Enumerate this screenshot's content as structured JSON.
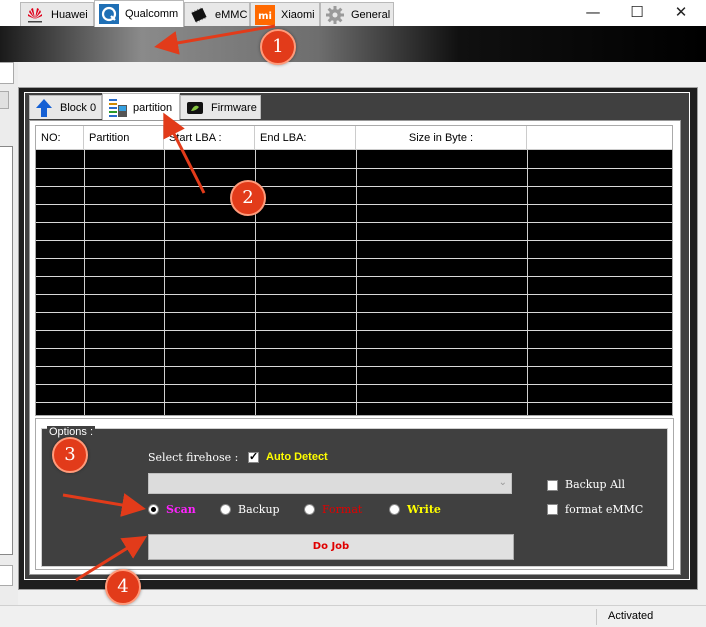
{
  "window": {
    "minimize_glyph": "—",
    "maximize_glyph": "☐",
    "close_glyph": "✕"
  },
  "main_tabs": [
    {
      "label": "Huawei",
      "icon": "huawei-logo-icon"
    },
    {
      "label": "Qualcomm",
      "icon": "qualcomm-logo-icon",
      "active": true
    },
    {
      "label": "eMMC",
      "icon": "emmc-chip-icon"
    },
    {
      "label": "Xiaomi",
      "icon": "xiaomi-logo-icon"
    },
    {
      "label": "General",
      "icon": "gear-icon"
    }
  ],
  "sub_tabs": [
    {
      "label": "Block 0",
      "icon": "upload-arrow-icon"
    },
    {
      "label": "partition",
      "icon": "partition-icon",
      "active": true
    },
    {
      "label": "Firmware",
      "icon": "firmware-chip-icon"
    }
  ],
  "table": {
    "columns": [
      "NO:",
      "Partition",
      "Start LBA :",
      "End LBA:",
      "Size in Byte :",
      ""
    ],
    "empty_rows": 15
  },
  "options": {
    "legend": "Options :",
    "select_firehose_label": "Select firehose :",
    "auto_detect_label": "Auto Detect",
    "auto_detect_checked": true,
    "firehose_value": "",
    "radios": [
      {
        "label": "Scan",
        "color": "#ff22ff",
        "selected": true
      },
      {
        "label": "Backup",
        "color": "#ffffff",
        "selected": false
      },
      {
        "label": "Format",
        "color": "#e00000",
        "selected": false
      },
      {
        "label": "Write",
        "color": "#ffff00",
        "selected": false
      }
    ],
    "backup_all_label": "Backup All",
    "backup_all_checked": false,
    "format_emmc_label": "format eMMC",
    "format_emmc_checked": false,
    "do_job_label": "Do Job"
  },
  "status": {
    "text": "Activated"
  },
  "annotations": {
    "marker_1": "1",
    "marker_2": "2",
    "marker_3": "3",
    "marker_4": "4",
    "accent_color": "#e23b1a"
  }
}
